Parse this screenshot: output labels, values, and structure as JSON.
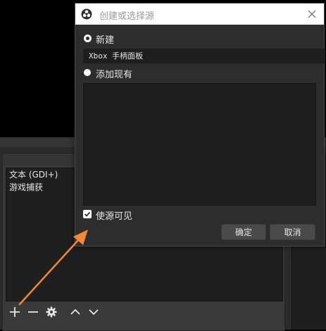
{
  "dialog": {
    "title": "创建或选择源",
    "new_option_label": "新建",
    "name_value": "Xbox 手柄面板",
    "existing_option_label": "添加现有",
    "visible_checkbox_label": "使源可见",
    "ok_label": "确定",
    "cancel_label": "取消",
    "new_option_selected": true,
    "visible_checked": true
  },
  "sources": {
    "items": [
      {
        "label": "文本 (GDI+)"
      },
      {
        "label": "游戏捕获"
      }
    ],
    "toolbar": [
      "add-icon",
      "remove-icon",
      "gear-icon",
      "chevron-up-icon",
      "chevron-down-icon"
    ]
  },
  "colors": {
    "annotation_arrow": "#f0883a",
    "dialog_bg": "#2d2d2d",
    "button_bg": "#4a4a4a"
  }
}
